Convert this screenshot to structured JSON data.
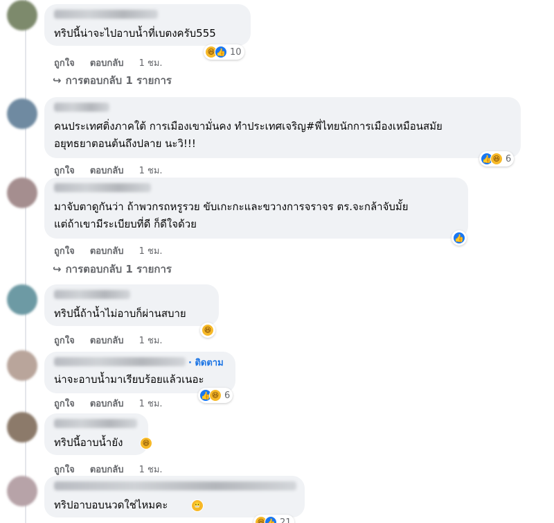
{
  "comments": [
    {
      "text_lines": [
        "ทริปนี้น่าจะไปอาบน้ำที่เบตงครับ555"
      ],
      "reactions": [
        "haha",
        "like"
      ],
      "reaction_count": "10",
      "actions": {
        "like": "ถูกใจ",
        "reply": "ตอบกลับ",
        "time": "1 ชม."
      },
      "replies": "การตอบกลับ 1 รายการ",
      "avatar_color": "#7d8a6c"
    },
    {
      "text_lines": [
        "คนประเทศติ่งภาคใต้ การเมืองเขามั่นคง ทำประเทศเจริญ#พี่ไทยนักการเมืองเหมือนสมัย",
        "อยุทธยาตอนต้นถึงปลาย นะวิ!!!"
      ],
      "reactions": [
        "like",
        "haha"
      ],
      "reaction_count": "6",
      "actions": {
        "like": "ถูกใจ",
        "reply": "ตอบกลับ",
        "time": "1 ชม."
      },
      "avatar_color": "#6f8aa1"
    },
    {
      "text_lines": [
        "มาจับตาดูกันว่า ถ้าพวกรถหรูรวย ขับเกะกะและขวางการจราจร ตร.จะกล้าจับมั้ย",
        "แต่ถ้าเขามีระเบียบที่ดี ก็ดีใจด้วย"
      ],
      "reactions": [
        "like"
      ],
      "reaction_count": "",
      "actions": {
        "like": "ถูกใจ",
        "reply": "ตอบกลับ",
        "time": "1 ชม."
      },
      "replies": "การตอบกลับ 1 รายการ",
      "avatar_color": "#a58e8f"
    },
    {
      "text_lines": [
        "ทริปนี้ถ้าน้ำไม่อาบก็ผ่านสบาย"
      ],
      "reactions": [
        "haha"
      ],
      "reaction_count": "",
      "actions": {
        "like": "ถูกใจ",
        "reply": "ตอบกลับ",
        "time": "1 ชม."
      },
      "avatar_color": "#6d9aa4"
    },
    {
      "follow": "· ติดตาม",
      "text_lines": [
        "น่าจะอาบน้ำมาเรียบร้อยแล้วเนอะ"
      ],
      "reactions": [
        "like",
        "haha"
      ],
      "reaction_count": "6",
      "actions": {
        "like": "ถูกใจ",
        "reply": "ตอบกลับ",
        "time": "1 ชม."
      },
      "avatar_color": "#b9a59b"
    },
    {
      "text_lines": [
        "ทริปนี้อาบน้ำยัง"
      ],
      "reactions": [
        "haha"
      ],
      "reaction_count": "",
      "actions": {
        "like": "ถูกใจ",
        "reply": "ตอบกลับ",
        "time": "1 ชม."
      },
      "avatar_color": "#8c7a6a"
    },
    {
      "text_lines": [
        "ทริปอาบอบนวดใช่ไหมคะ"
      ],
      "reactions": [
        "haha",
        "like"
      ],
      "reaction_count": "21",
      "avatar_color": "#b7a3a8"
    }
  ],
  "icons": {
    "like": "thumbs-up-icon",
    "haha": "laughing-face-icon",
    "wow": "face-icon",
    "reply_arrow": "reply-arrow-icon"
  },
  "colors": {
    "bubble": "#f0f2f5",
    "link": "#1b74e4",
    "meta": "#65676b",
    "like": "#1877f2",
    "haha": "#f7b928"
  }
}
